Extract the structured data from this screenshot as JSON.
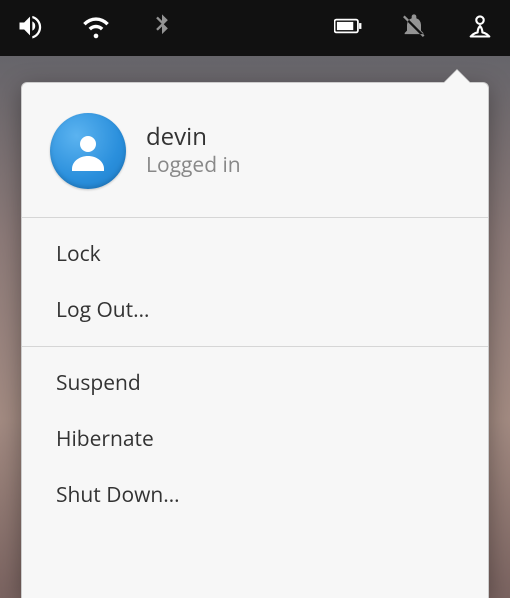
{
  "user": {
    "name": "devin",
    "status": "Logged in"
  },
  "session_menu": {
    "lock": "Lock",
    "logout": "Log Out…"
  },
  "power_menu": {
    "suspend": "Suspend",
    "hibernate": "Hibernate",
    "shutdown": "Shut Down…"
  }
}
